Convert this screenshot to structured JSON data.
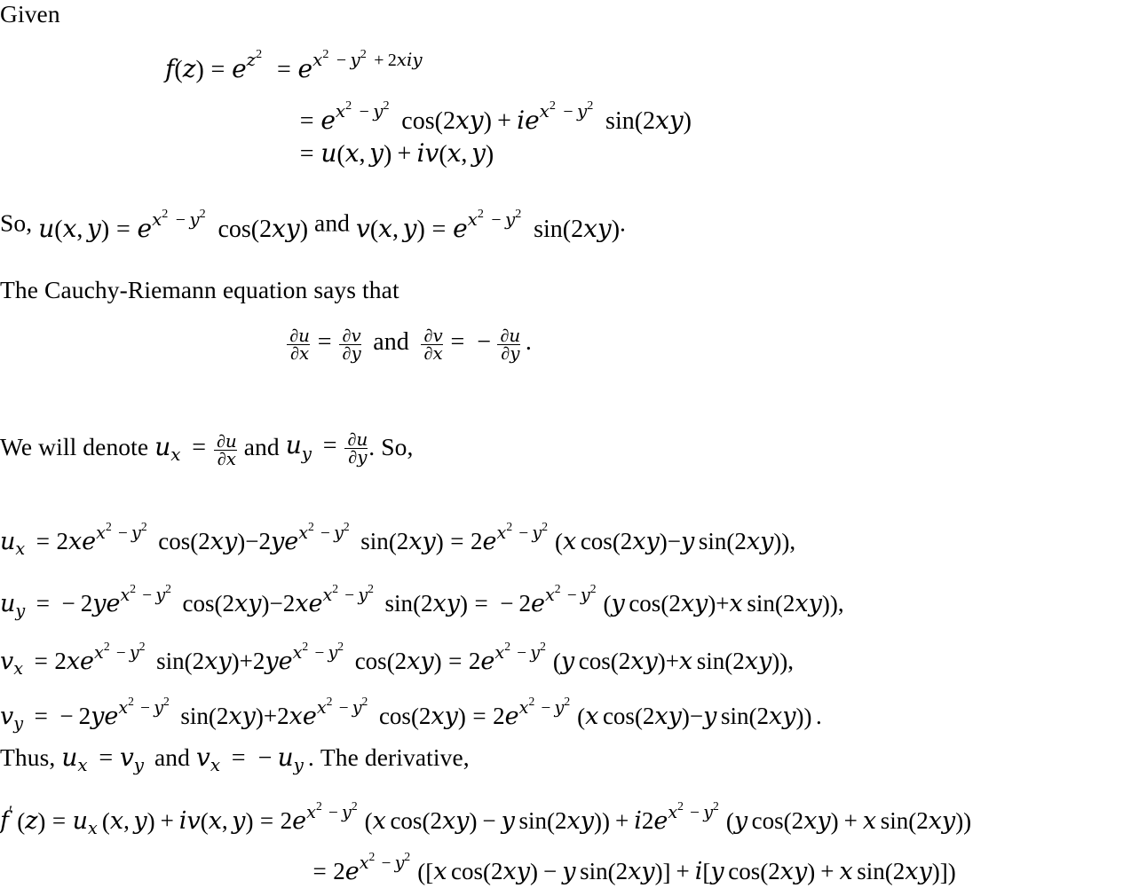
{
  "document": {
    "kind": "latex-math-proof",
    "topic": "Cauchy-Riemann equations for f(z) = e^{z^2}",
    "background_color": "#ffffff",
    "text_color": "#000000"
  },
  "lines": {
    "given_label": "Given",
    "so_prefix": "So,",
    "and_word": "and",
    "period": ".",
    "comma": ",",
    "cauchy_riemann_intro": "The Cauchy-Riemann equation says that",
    "denote_prefix": "We will denote",
    "denote_suffix": "So,",
    "thus_prefix": "Thus,",
    "thus_suffix": "The derivative,"
  },
  "equations": {
    "eq_fz": {
      "latex": "f(z) = e^{z^2} = e^{x^2-y^2+2xiy}",
      "plain": "f(z) = e^{z^2} = e^{x^2 - y^2 + 2xiy}"
    },
    "eq_cos": {
      "latex": "= e^{x^2-y^2}\\cos(2xy) + ie^{x^2-y^2}\\sin(2xy)",
      "plain": "= e^{x^2-y^2} cos(2xy) + i e^{x^2-y^2} sin(2xy)"
    },
    "eq_uiv": {
      "latex": "= u(x,y) + iv(x,y)",
      "plain": "= u(x,y) + iv(x,y)"
    },
    "eq_u_def": {
      "latex": "u(x,y) = e^{x^2-y^2}\\cos(2xy)",
      "plain": "u(x,y) = e^{x^2-y^2} cos(2xy)"
    },
    "eq_v_def": {
      "latex": "v(x,y) = e^{x^2-y^2}\\sin(2xy)",
      "plain": "v(x,y) = e^{x^2-y^2} sin(2xy)"
    },
    "eq_cr_first": {
      "latex": "\\frac{\\partial u}{\\partial x} = \\frac{\\partial v}{\\partial y}",
      "plain": "du/dx = dv/dy"
    },
    "eq_cr_second": {
      "latex": "\\frac{\\partial v}{\\partial x} = -\\frac{\\partial u}{\\partial y}",
      "plain": "dv/dx = -du/dy"
    },
    "eq_denote_ux": {
      "latex": "u_x = \\frac{\\partial u}{\\partial x}",
      "plain": "u_x = du/dx"
    },
    "eq_denote_uy": {
      "latex": "u_y = \\frac{\\partial u}{\\partial y}",
      "plain": "u_y = du/dy"
    },
    "eq_ux": {
      "latex": "u_x = 2xe^{x^2-y^2}\\cos(2xy)-2ye^{x^2-y^2}\\sin(2xy) = 2e^{x^2-y^2}(x\\cos(2xy)-y\\sin(2xy)),",
      "plain": "u_x = 2xe^{x^2-y^2} cos(2xy) - 2ye^{x^2-y^2} sin(2xy) = 2e^{x^2-y^2}(x cos(2xy) - y sin(2xy)),"
    },
    "eq_uy": {
      "latex": "u_y = -2ye^{x^2-y^2}\\cos(2xy)-2xe^{x^2-y^2}\\sin(2xy) = -2e^{x^2-y^2}(y\\cos(2xy)+x\\sin(2xy)),",
      "plain": "u_y = -2ye^{x^2-y^2} cos(2xy) - 2xe^{x^2-y^2} sin(2xy) = -2e^{x^2-y^2}(y cos(2xy) + x sin(2xy)),"
    },
    "eq_vx": {
      "latex": "v_x = 2xe^{x^2-y^2}\\sin(2xy)+2ye^{x^2-y^2}\\cos(2xy) = 2e^{x^2-y^2}(y\\cos(2xy)+x\\sin(2xy)),",
      "plain": "v_x = 2xe^{x^2-y^2} sin(2xy) + 2ye^{x^2-y^2} cos(2xy) = 2e^{x^2-y^2}(y cos(2xy) + x sin(2xy)),"
    },
    "eq_vy": {
      "latex": "v_y = -2ye^{x^2-y^2}\\sin(2xy)+2xe^{x^2-y^2}\\cos(2xy) = 2e^{x^2-y^2}(x\\cos(2xy)-y\\sin(2xy)).",
      "plain": "v_y = -2ye^{x^2-y^2} sin(2xy) + 2xe^{x^2-y^2} cos(2xy) = 2e^{x^2-y^2}(x cos(2xy) - y sin(2xy))."
    },
    "eq_thus_1": {
      "latex": "u_x = v_y",
      "plain": "u_x = v_y"
    },
    "eq_thus_2": {
      "latex": "v_x = -u_y",
      "plain": "v_x = -u_y"
    },
    "eq_fprime": {
      "latex": "f'(z) = u_x(x,y) + iv(x,y) = 2e^{x^2-y^2}(x\\cos(2xy)-y\\sin(2xy)) + i2e^{x^2-y^2}(y\\cos(2xy)+x\\sin(2xy))",
      "plain": "f'(z) = u_x(x,y) + iv(x,y) = 2e^{x^2-y^2}(x cos(2xy) - y sin(2xy)) + i2e^{x^2-y^2}(y cos(2xy) + x sin(2xy))"
    },
    "eq_fprime2": {
      "latex": "= 2e^{x^2-y^2}\\Big([x\\cos(2xy)-y\\sin(2xy)]+i[y\\cos(2xy)+x\\sin(2xy)]\\Big)",
      "plain": "= 2e^{x^2-y^2} ([x cos(2xy) - y sin(2xy)] + i[y cos(2xy) + x sin(2xy)])"
    }
  },
  "symbols": {
    "eq": "=",
    "plus": "+",
    "minus": "−",
    "partial": "∂",
    "i": "i",
    "x": "x",
    "y": "y",
    "z": "z",
    "u": "u",
    "v": "v",
    "f": "f",
    "prime": "′",
    "two": "2",
    "cos": "cos",
    "sin": "sin",
    "e": "e",
    "lparen": "(",
    "rparen": ")",
    "lbrack": "[",
    "rbrack": "]"
  }
}
